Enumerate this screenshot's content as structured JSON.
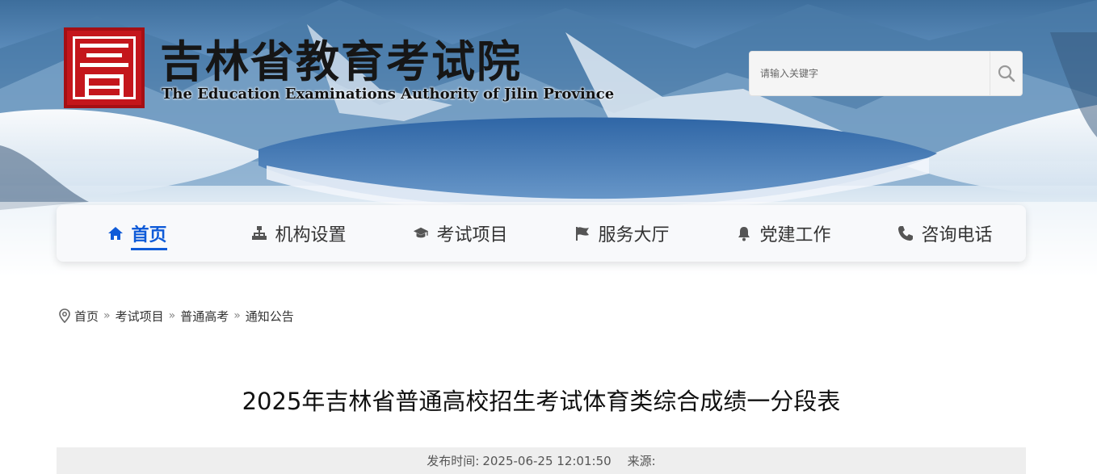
{
  "site": {
    "title": "吉林省教育考试院",
    "subtitle": "The Education Examinations Authority of Jilin Province"
  },
  "search": {
    "placeholder": "请输入关键字",
    "value": ""
  },
  "nav": [
    {
      "label": "首页",
      "icon": "home-icon",
      "active": true
    },
    {
      "label": "机构设置",
      "icon": "org-chart-icon",
      "active": false
    },
    {
      "label": "考试项目",
      "icon": "graduation-cap-icon",
      "active": false
    },
    {
      "label": "服务大厅",
      "icon": "flag-icon",
      "active": false
    },
    {
      "label": "党建工作",
      "icon": "bell-icon",
      "active": false
    },
    {
      "label": "咨询电话",
      "icon": "phone-icon",
      "active": false
    }
  ],
  "breadcrumb": [
    "首页",
    "考试项目",
    "普通高考",
    "通知公告"
  ],
  "article": {
    "title": "2025年吉林省普通高校招生考试体育类综合成绩一分段表",
    "publish_label": "发布时间:",
    "publish_time": "2025-06-25 12:01:50",
    "source_label": "来源:",
    "source": ""
  },
  "colors": {
    "accent": "#0f5bd8",
    "seal": "#c4161c",
    "meta_bg": "#eeeeee"
  }
}
